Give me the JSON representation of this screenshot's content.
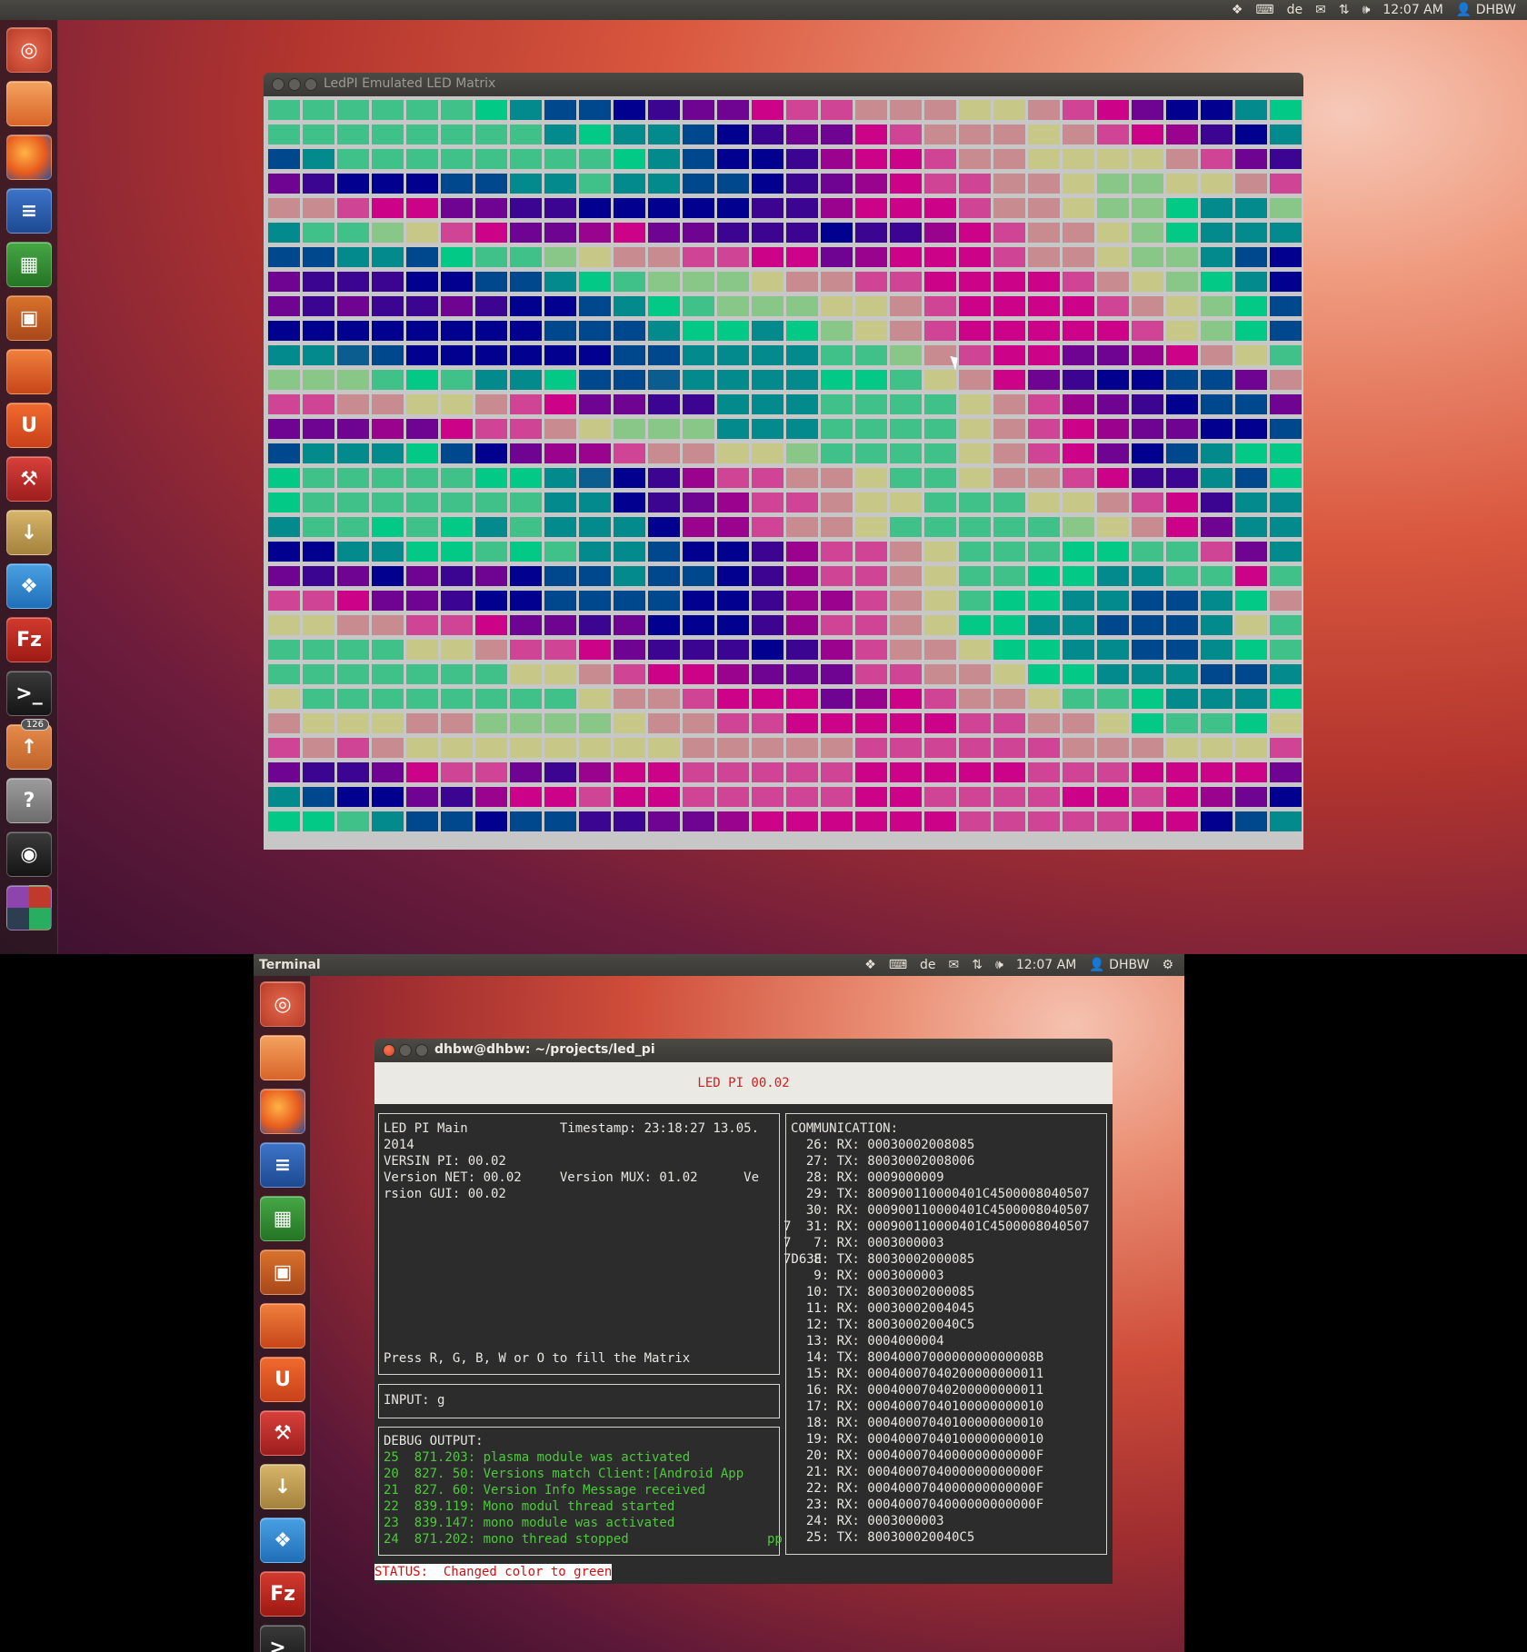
{
  "top_panel": {
    "keyboard_layout": "de",
    "clock": "12:07 AM",
    "user": "DHBW"
  },
  "terminal_panel": {
    "title": "Terminal",
    "keyboard_layout": "de",
    "clock": "12:07 AM",
    "user": "DHBW"
  },
  "launcher": {
    "items": [
      "Dash Home",
      "Files",
      "Firefox",
      "LibreOffice Writer",
      "LibreOffice Calc",
      "LibreOffice Impress",
      "Ubuntu Software Center",
      "Ubuntu One",
      "System Settings",
      "Software Updater",
      "Dropbox",
      "FileZilla",
      "Terminal",
      "Update Manager",
      "Help",
      "Webcam",
      "Workspace Switcher",
      "Trash"
    ],
    "updates_badge": "126"
  },
  "led_window": {
    "title": "LedPI Emulated LED Matrix",
    "palette": {
      "T": "#3fc189",
      "G": "#02c986",
      "E": "#028a8c",
      "L": "#00488e",
      "N": "#02008e",
      "I": "#3b0592",
      "V": "#6f0492",
      "P": "#9a038e",
      "M": "#cc0388",
      "K": "#d04496",
      "R": "#c88b8f",
      "Y": "#c7c787",
      "A": "#89c789",
      "B": "#0a5d8e"
    },
    "rows": [
      "TTTTTTGELLNIVVMKKRRRYYRKMVNNEG",
      "TTTTTTTTEGEELNIVVMKRRRYRKMPINE",
      "LETTTTTTTTGELNNIPMMKRRYYYYRKVI",
      "VINNNLLEETEELLNIVPMKKRRYAAYYRK",
      "RRKMMVVIINNNNNIIPMMMKRRYAAGEEA",
      "ETTAYKMVVPMVVIIINIIPMKRRYAGEEE",
      "LLEELGTTAYRRKKMMVPMMMKRRYAAELN",
      "VIIINNLLEGTAAAYRRKKMMMMKRYAGEN",
      "VIVIIVINNLEGTAAAYYRKMMMMKRYAGL",
      "NNNNNNNNLLLEGGEGAYRKMMMMMKYAGL",
      "EEBLNNNNNNLLEEEETTARKMMVVPMRYT",
      "AAATGTEEGLLBEEEEGGTYRMVINNLLVR",
      "KKRRYYRKMVVIIEEETTTTYRKPVINLLV",
      "VVVPVMKKRYAAAEEETTTTYRKMPVVNNL",
      "LEEEGLNVPPKRRYYATTTTYRKMVNLEGG",
      "GTTTTTGGEBNIPKKRRYTTYRRKMIIELG",
      "GTTTTTTTEENIVPKKRYYTTTYYRKMIEE",
      "ETTGTGETEEENPPKRRYTTTTTAYRMVEE",
      "NNEEGGTGTEELNNIPKKRYTTTGGTTKVE",
      "VIVNVIVNLLELLNIPKKRYTTGGEETTMT",
      "KKMVVINNLLLLNNIPPKRYTGGEELLEGR",
      "YYRRKKMVVIVNNNIPKKRYGGEELLLEYT",
      "TTTTYYRKKMVIIINIPKRRYGGEELLEGT",
      "TTTTTTTYYRKMMPVVVKKRRYGGEEELLE",
      "YTTTTTTTTYRRKMMMVPMKRRYTTGEEEG",
      "RYYYRRAAAAYRRKKMMMMMKKRRYGTTGY",
      "KRKRYYYYYYYYRRRRRKKKKKKRRRYYYK",
      "VIIVMKKVIPMMKKKKKMMMMMKKKMMMMV",
      "ELNNVIPMMKMMKKKKKMMKKKKMMKMPVN",
      "GGTELLNLLIIVVPMMMMMMKKKKKMMNLE"
    ]
  },
  "terminal_window": {
    "title": "dhbw@dhbw: ~/projects/led_pi",
    "header": "LED PI 00.02",
    "main_panel": [
      "LED PI Main            Timestamp: 23:18:27 13.05.",
      "2014",
      "VERSIN PI: 00.02",
      "Version NET: 00.02     Version MUX: 01.02      Ve",
      "rsion GUI: 00.02"
    ],
    "main_hint": "Press R, G, B, W or O to fill the Matrix",
    "input_label": "INPUT: g",
    "debug_title": "DEBUG OUTPUT:",
    "debug_lines": [
      "25  871.203: plasma module was activated",
      "20  827. 50: Versions match Client:[Android App",
      "21  827. 60: Version Info Message received",
      "22  839.119: Mono modul thread started",
      "23  839.147: mono module was activated",
      "24  871.202: mono thread stopped"
    ],
    "debug_trailing": "pp",
    "communication_title": "COMMUNICATION:",
    "communication_lines": [
      "  26: RX: 00030002008085",
      "  27: TX: 80030002008006",
      "  28: RX: 0009000009",
      "  29: TX: 800900110000401C4500008040507",
      "  30: RX: 000900110000401C4500008040507",
      "  31: RX: 000900110000401C4500008040507",
      "   7: RX: 0003000003",
      "   8: TX: 80030002000085",
      "   9: RX: 0003000003",
      "  10: TX: 80030002000085",
      "  11: RX: 00030002004045",
      "  12: TX: 800300020040C5",
      "  13: RX: 0004000004",
      "  14: TX: 8004000700000000000008B",
      "  15: RX: 00040007040200000000011",
      "  16: RX: 00040007040200000000011",
      "  17: RX: 00040007040100000000010",
      "  18: RX: 00040007040100000000010",
      "  19: RX: 00040007040100000000010",
      "  20: RX: 0004000704000000000000F",
      "  21: RX: 0004000704000000000000F",
      "  22: RX: 0004000704000000000000F",
      "  23: RX: 0004000704000000000000F",
      "  24: RX: 0003000003",
      "  25: TX: 800300020040C5"
    ],
    "overflow_marks": [
      "7",
      "7",
      "7D63E"
    ],
    "status": "STATUS:  Changed color to green"
  }
}
